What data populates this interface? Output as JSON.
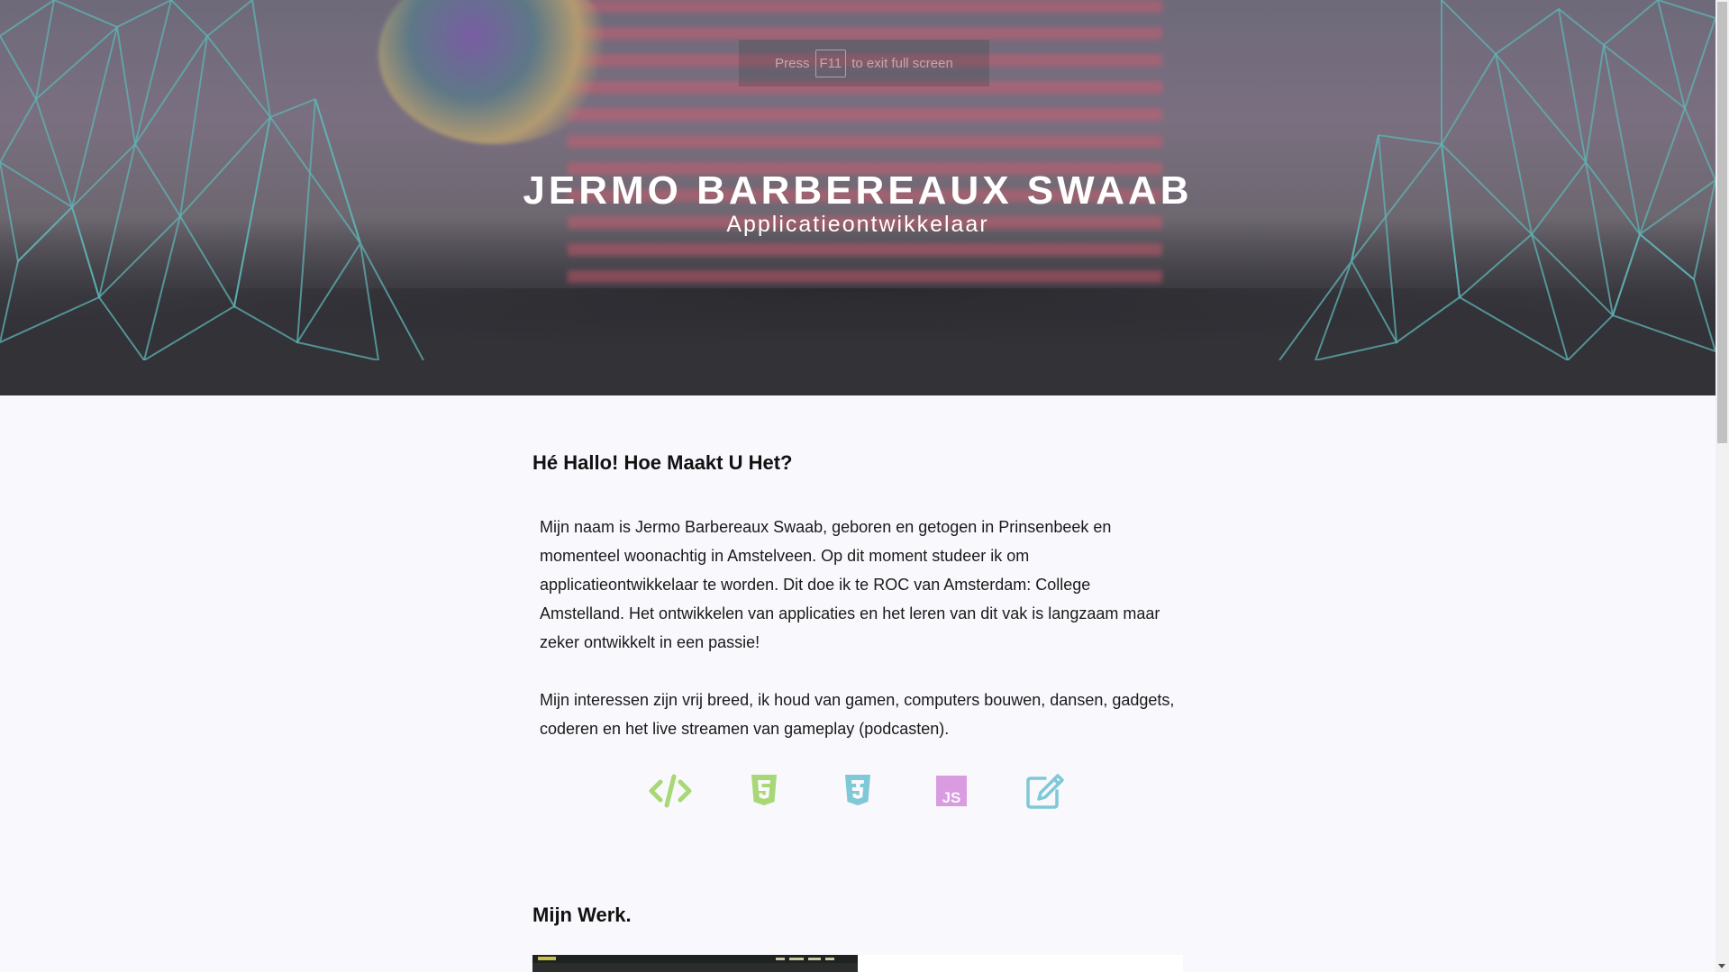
{
  "fullscreen_notice": {
    "prefix": "Press",
    "key": "F11",
    "suffix": "to exit full screen"
  },
  "hero": {
    "title": "JERMO BARBEREAUX SWAAB",
    "subtitle": "Applicatieontwikkelaar"
  },
  "about": {
    "title": "Hé Hallo! Hoe Maakt U Het?",
    "paragraphs": [
      "Mijn naam is Jermo Barbereaux Swaab, geboren en getogen in Prinsenbeek en momenteel woonachtig in Amstelveen. Op dit moment studeer ik om applicatieontwikkelaar te worden. Dit doe ik te ROC van Amsterdam: College Amstelland. Het ontwikkelen van applicaties en het leren van dit vak is langzaam maar zeker ontwikkelt in een passie!",
      "Mijn interessen zijn vrij breed, ik houd van gamen, computers bouwen, dansen, gadgets, coderen en het live streamen van gameplay (podcasten)."
    ]
  },
  "skills": [
    {
      "icon": "code-icon",
      "color": "#a8d876"
    },
    {
      "icon": "html5-icon",
      "color": "#a8d876"
    },
    {
      "icon": "css3-icon",
      "color": "#7ec8d8"
    },
    {
      "icon": "javascript-icon",
      "color": "#d99ce0",
      "label": "JS"
    },
    {
      "icon": "edit-icon",
      "color": "#7ec8d8"
    }
  ],
  "work": {
    "title": "Mijn Werk."
  },
  "colors": {
    "page_background": "#f9f8fc",
    "hero_dark": "#333237",
    "mesh_line": "#5fb3b3"
  }
}
